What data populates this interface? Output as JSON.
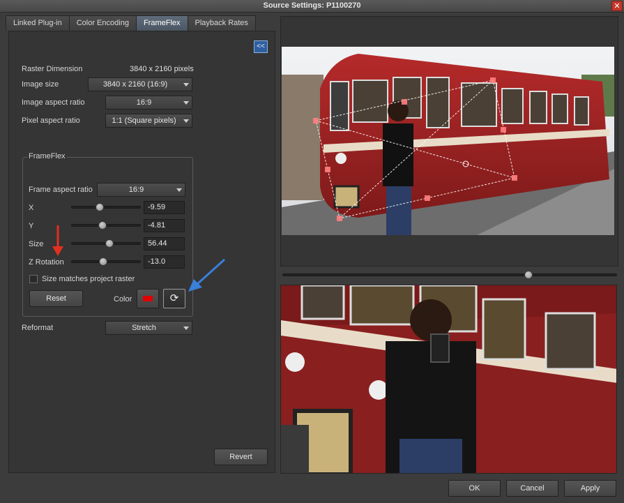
{
  "window": {
    "title": "Source Settings: P1100270"
  },
  "tabs": [
    {
      "label": "Linked Plug-in"
    },
    {
      "label": "Color Encoding"
    },
    {
      "label": "FrameFlex",
      "active": true
    },
    {
      "label": "Playback Rates"
    }
  ],
  "panel": {
    "collapse_label": "<<",
    "raster_dimension": {
      "label": "Raster Dimension",
      "value": "3840 x 2160 pixels"
    },
    "image_size": {
      "label": "Image size",
      "value": "3840 x 2160 (16:9)"
    },
    "image_aspect_ratio": {
      "label": "Image aspect ratio",
      "value": "16:9"
    },
    "pixel_aspect_ratio": {
      "label": "Pixel aspect ratio",
      "value": "1:1 (Square pixels)"
    },
    "frameflex": {
      "title": "FrameFlex",
      "frame_aspect_ratio": {
        "label": "Frame aspect ratio",
        "value": "16:9"
      },
      "x": {
        "label": "X",
        "value": "-9.59"
      },
      "y": {
        "label": "Y",
        "value": "-4.81"
      },
      "size": {
        "label": "Size",
        "value": "56.44"
      },
      "z_rotation": {
        "label": "Z Rotation",
        "value": "-13.0"
      },
      "size_matches_label": "Size matches project raster",
      "size_matches_checked": false,
      "reset_label": "Reset",
      "color_label": "Color",
      "overlay_color": "#e00000"
    },
    "reformat": {
      "label": "Reformat",
      "value": "Stretch"
    },
    "revert_label": "Revert"
  },
  "annotations": {
    "red_arrow_color": "#e03020",
    "blue_arrow_color": "#3a7fd8"
  },
  "footer": {
    "ok_label": "OK",
    "cancel_label": "Cancel",
    "apply_label": "Apply"
  }
}
